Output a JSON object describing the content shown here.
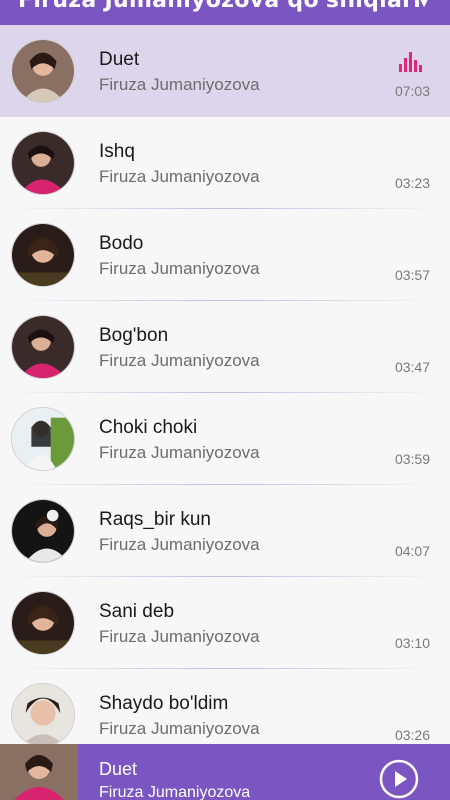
{
  "header": {
    "title": "Firuza Jumaniyozova qo'shiqlari",
    "bg_color": "#7b55c2",
    "menu_icon": "chevron-down-icon"
  },
  "songs": [
    {
      "title": "Duet",
      "artist": "Firuza Jumaniyozova",
      "duration": "07:03",
      "playing": true
    },
    {
      "title": "Ishq",
      "artist": "Firuza Jumaniyozova",
      "duration": "03:23"
    },
    {
      "title": "Bodo",
      "artist": "Firuza Jumaniyozova",
      "duration": "03:57"
    },
    {
      "title": "Bog'bon",
      "artist": "Firuza Jumaniyozova",
      "duration": "03:47"
    },
    {
      "title": "Choki choki",
      "artist": "Firuza Jumaniyozova",
      "duration": "03:59"
    },
    {
      "title": "Raqs_bir kun",
      "artist": "Firuza Jumaniyozova",
      "duration": "04:07"
    },
    {
      "title": "Sani deb",
      "artist": "Firuza Jumaniyozova",
      "duration": "03:10"
    },
    {
      "title": "Shaydo bo'ldim",
      "artist": "Firuza Jumaniyozova",
      "duration": "03:26"
    }
  ],
  "player": {
    "title": "Duet",
    "artist": "Firuza Jumaniyozova",
    "play_icon": "play-icon"
  },
  "colors": {
    "accent": "#7b55c2",
    "active_row": "#dcd5ec",
    "equalizer": "#e0287a"
  }
}
